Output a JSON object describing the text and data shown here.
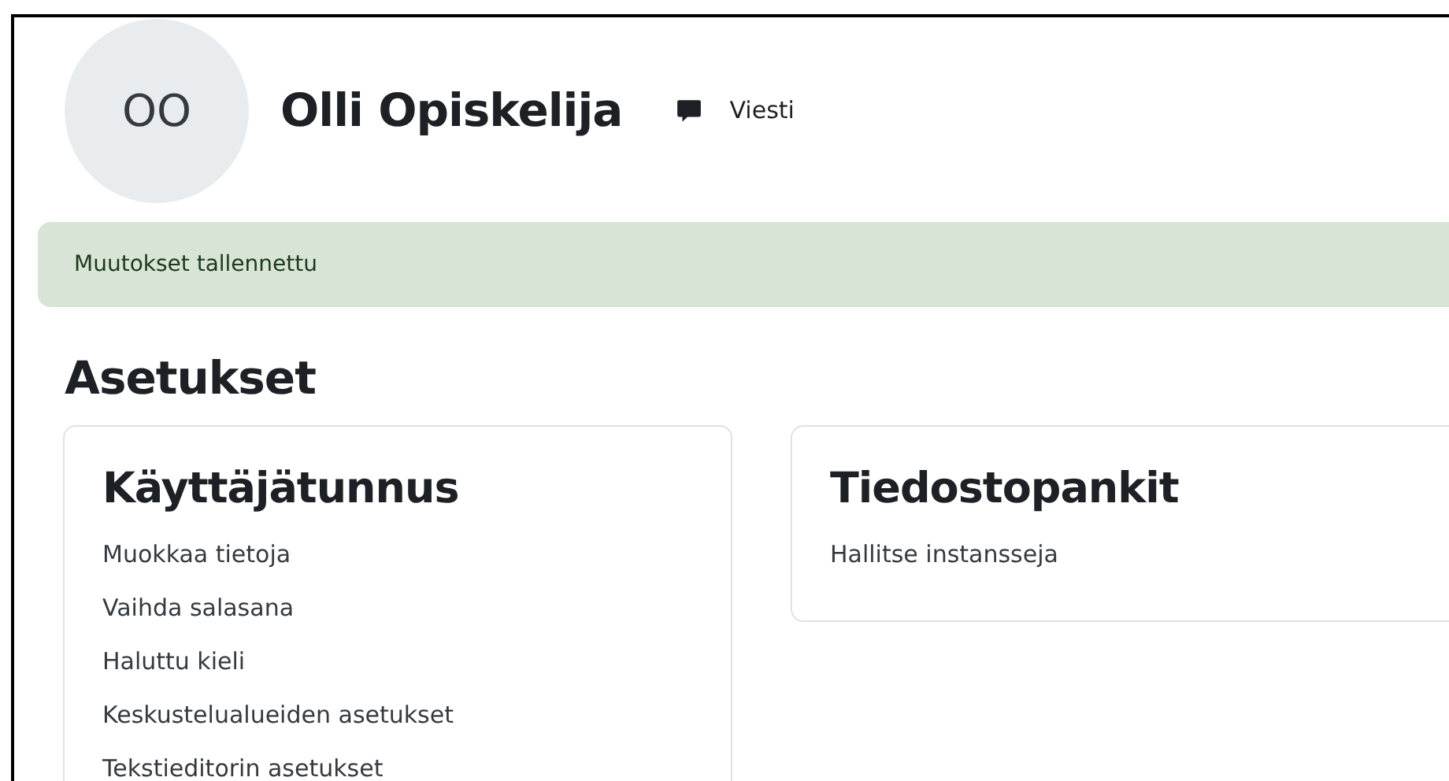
{
  "profile": {
    "initials": "OO",
    "name": "Olli Opiskelija",
    "message_button": "Viesti"
  },
  "alert": {
    "text": "Muutokset tallennettu"
  },
  "section_title": "Asetukset",
  "cards": [
    {
      "title": "Käyttäjätunnus",
      "links": [
        "Muokkaa tietoja",
        "Vaihda salasana",
        "Haluttu kieli",
        "Keskustelualueiden asetukset",
        "Tekstieditorin asetukset"
      ]
    },
    {
      "title": "Tiedostopankit",
      "links": [
        "Hallitse instansseja"
      ]
    }
  ]
}
